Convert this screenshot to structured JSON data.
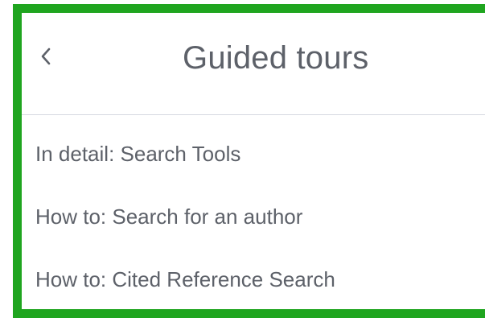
{
  "panel": {
    "title": "Guided tours",
    "back_icon": "chevron-left-icon"
  },
  "tours": [
    {
      "label": "In detail: Search Tools"
    },
    {
      "label": "How to: Search for an author"
    },
    {
      "label": "How to: Cited Reference Search"
    }
  ],
  "colors": {
    "frame_highlight": "#1fa51f",
    "text": "#5d6169",
    "divider": "#d6d9e0"
  }
}
